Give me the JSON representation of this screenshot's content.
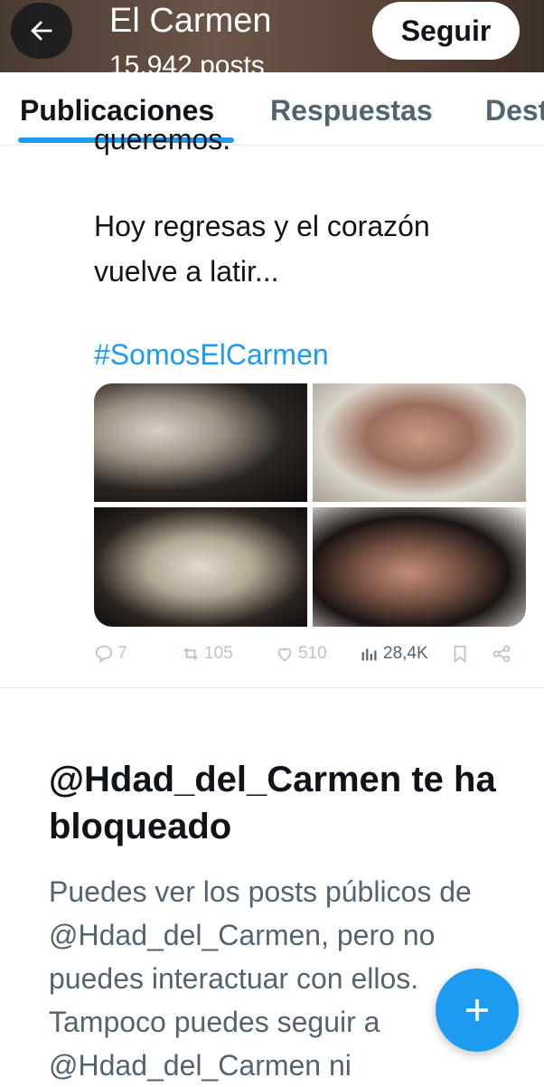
{
  "header": {
    "title": "El Carmen",
    "subtitle": "15.942 posts",
    "follow_label": "Seguir"
  },
  "tabs": [
    {
      "label": "Publicaciones"
    },
    {
      "label": "Respuestas"
    },
    {
      "label": "Destacados"
    }
  ],
  "post": {
    "cut_line": "queremos.",
    "line1": "Hoy regresas y el corazón",
    "line2": "vuelve a latir...",
    "hashtag": "#SomosElCarmen",
    "replies": "7",
    "reposts": "105",
    "likes": "510",
    "views": "28,4K"
  },
  "blocked": {
    "title": "@Hdad_del_Carmen te ha bloqueado",
    "description": "Puedes ver los posts públicos de @Hdad_del_Carmen, pero no puedes interactuar con ellos. Tampoco puedes seguir a @Hdad_del_Carmen ni"
  },
  "colors": {
    "accent": "#1d9bf0",
    "text_primary": "#0f1419",
    "text_secondary": "#536471"
  },
  "icons": [
    "back-arrow-icon",
    "reply-icon",
    "repost-icon",
    "like-icon",
    "views-icon",
    "bookmark-icon",
    "share-icon",
    "plus-icon"
  ]
}
